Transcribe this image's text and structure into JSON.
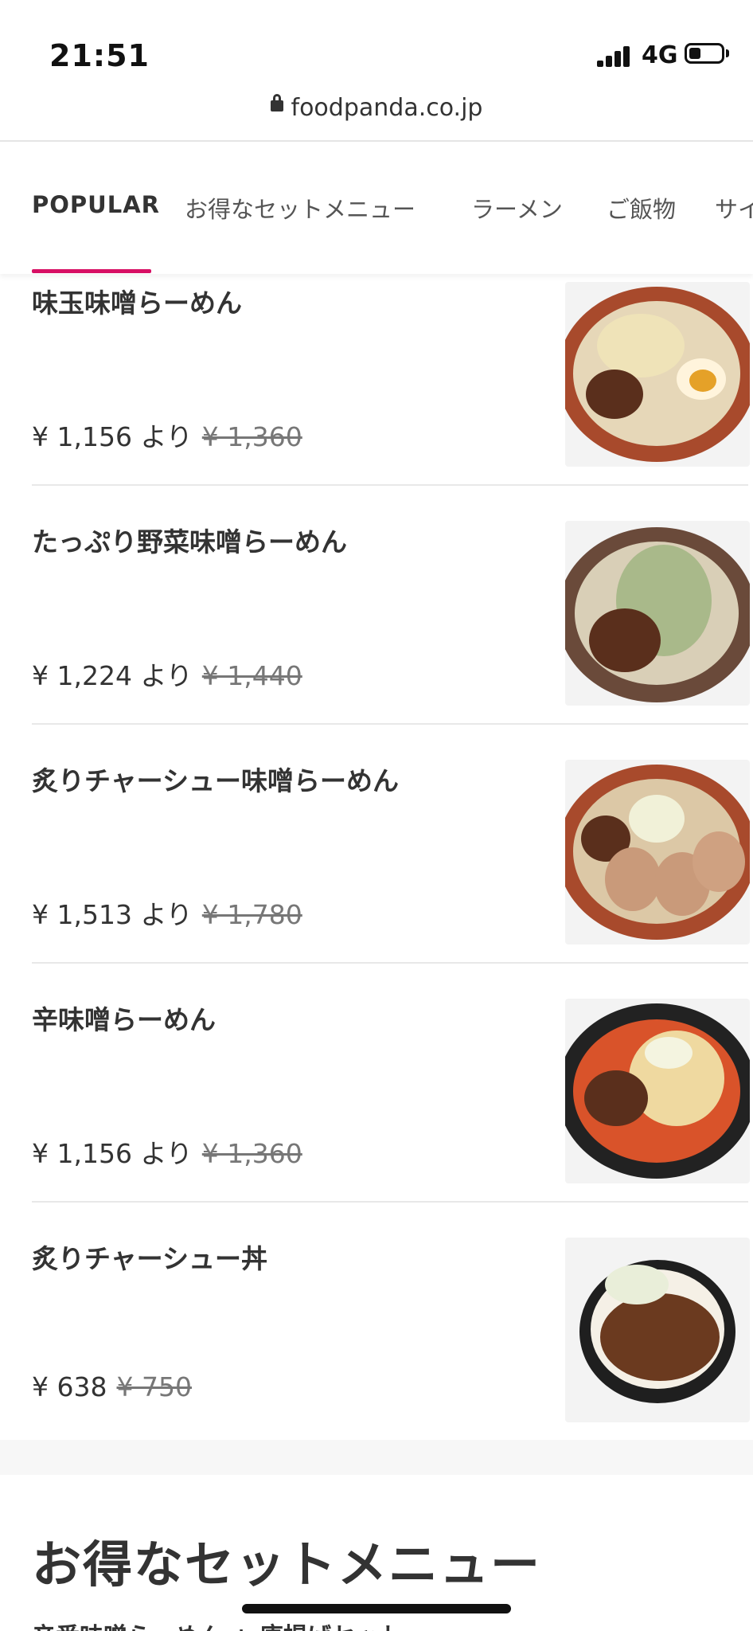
{
  "status": {
    "time": "21:51",
    "network": "4G",
    "battery_icon": "battery-low-icon",
    "signal_icon": "signal-bars-icon"
  },
  "url_bar": {
    "lock_icon": "lock-icon",
    "domain": "foodpanda.co.jp"
  },
  "tabs": [
    {
      "label": "POPULAR"
    },
    {
      "label": "お得なセットメニュー"
    },
    {
      "label": "ラーメン"
    },
    {
      "label": "ご飯物"
    },
    {
      "label": "サイ"
    }
  ],
  "accent": "#d70f64",
  "items": [
    {
      "name": "味玉味噌らーめん",
      "price": "¥ 1,156 より",
      "original": "¥ 1,360"
    },
    {
      "name": "たっぷり野菜味噌らーめん",
      "price": "¥ 1,224 より",
      "original": "¥ 1,440"
    },
    {
      "name": "炙りチャーシュー味噌らーめん",
      "price": "¥ 1,513 より",
      "original": "¥ 1,780"
    },
    {
      "name": "辛味噌らーめん",
      "price": "¥ 1,156 より",
      "original": "¥ 1,360"
    },
    {
      "name": "炙りチャーシュー丼",
      "price": "¥ 638",
      "original": "¥ 750"
    }
  ],
  "section": {
    "title": "お得なセットメニュー",
    "next_item_partial": "辛番味噌らーめん + 唐揚げセット"
  }
}
